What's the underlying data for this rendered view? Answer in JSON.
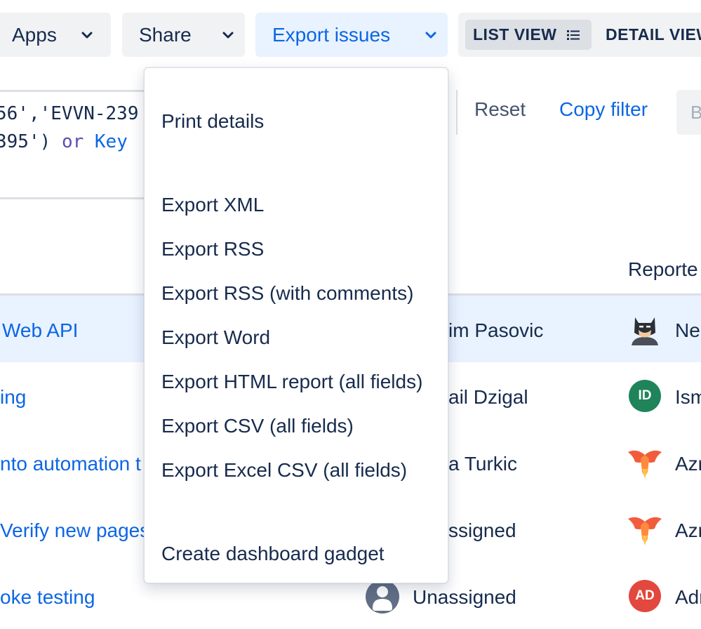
{
  "toolbar": {
    "apps_label": "Apps",
    "share_label": "Share",
    "export_label": "Export issues",
    "list_view_label": "LIST VIEW",
    "detail_view_label": "DETAIL VIEW"
  },
  "query": {
    "line1": "56','EVVN-239",
    "line2_value": "395')",
    "line2_keyword": "or",
    "line2_field": "Key"
  },
  "filter_actions": {
    "reset_label": "Reset",
    "copy_filter_label": "Copy filter",
    "partial_button_label": "B"
  },
  "table": {
    "reporter_header": "Reporte",
    "rows": [
      {
        "summary": "Web API",
        "assignee": "im Pasovic",
        "reporter": "Ne",
        "highlighted": true
      },
      {
        "summary": "ing",
        "assignee": "ail Dzigal",
        "reporter": "Ism",
        "reporter_initials": "ID"
      },
      {
        "summary": "nto automation t",
        "assignee": "a Turkic",
        "reporter": "Azr"
      },
      {
        "summary": "Verify new pages",
        "assignee": "ssigned",
        "reporter": "Azr"
      },
      {
        "summary": "oke testing",
        "assignee": "Unassigned",
        "reporter": "Adr",
        "reporter_initials": "AD"
      }
    ]
  },
  "export_menu": {
    "print_details": "Print details",
    "export_xml": "Export XML",
    "export_rss": "Export RSS",
    "export_rss_comments": "Export RSS (with comments)",
    "export_word": "Export Word",
    "export_html": "Export HTML report (all fields)",
    "export_csv": "Export CSV (all fields)",
    "export_excel_csv": "Export Excel CSV (all fields)",
    "create_gadget": "Create dashboard gadget"
  },
  "colors": {
    "link_blue": "#0c66e4",
    "avatar_green": "#1f845a",
    "avatar_red": "#e2483d",
    "selected_bg": "#e9f2ff"
  },
  "icons": [
    "chevron-down-icon",
    "list-icon",
    "batman-avatar-icon",
    "phoenix-avatar-icon",
    "unassigned-user-icon"
  ]
}
